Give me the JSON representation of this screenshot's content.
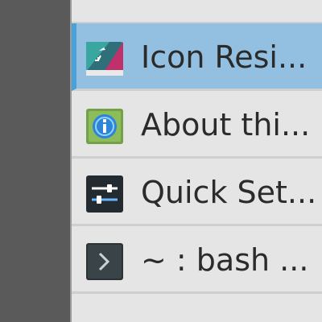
{
  "taskbar": {
    "items": [
      {
        "label": "Icon Resi...",
        "icon": "icon-resizer-icon",
        "active": true
      },
      {
        "label": "About thi...",
        "icon": "about-info-icon",
        "active": false
      },
      {
        "label": "Quick Set...",
        "icon": "quick-settings-icon",
        "active": false
      },
      {
        "label": "~ : bash ...",
        "icon": "terminal-icon",
        "active": false
      }
    ]
  },
  "colors": {
    "active_highlight": "#93c0e0",
    "active_accent": "#4aa0db",
    "left_pane": "#5a5a5a",
    "list_background": "#e5e5e5"
  }
}
